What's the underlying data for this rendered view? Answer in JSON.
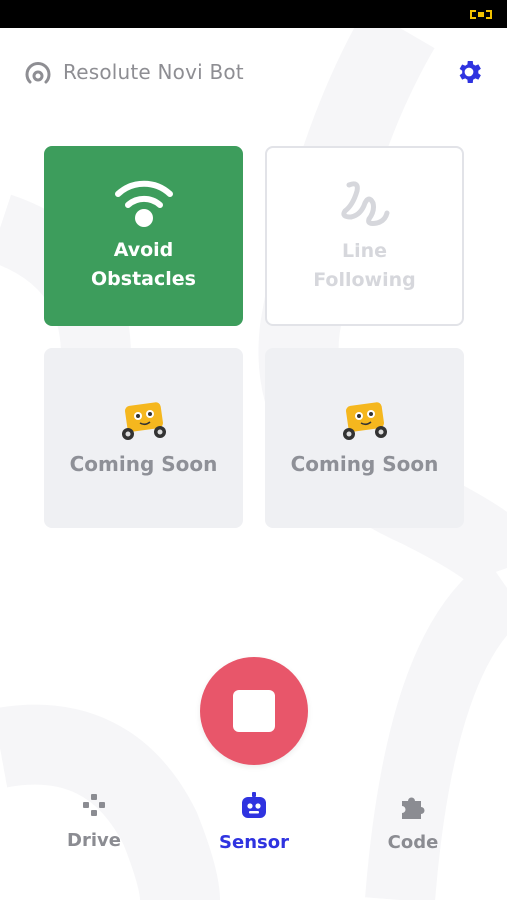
{
  "header": {
    "title": "Resolute Novi Bot",
    "signal_icon": "signal-icon",
    "settings_icon": "gear-icon"
  },
  "cards": {
    "avoid": {
      "label": "Avoid\nObstacles",
      "icon": "wifi-icon"
    },
    "line": {
      "label": "Line\nFollowing",
      "icon": "squiggle-line-icon"
    },
    "soon1": {
      "label": "Coming Soon",
      "icon": "robot-mascot-icon"
    },
    "soon2": {
      "label": "Coming Soon",
      "icon": "robot-mascot-icon"
    }
  },
  "stop": {
    "icon": "stop-icon"
  },
  "nav": {
    "drive": {
      "label": "Drive",
      "icon": "gamepad-icon"
    },
    "sensor": {
      "label": "Sensor",
      "icon": "robot-icon"
    },
    "code": {
      "label": "Code",
      "icon": "puzzle-icon"
    }
  },
  "colors": {
    "accent": "#2f33e0",
    "active_card": "#3d9d5c",
    "stop_button": "#e8566a",
    "battery": "#f2c200"
  }
}
